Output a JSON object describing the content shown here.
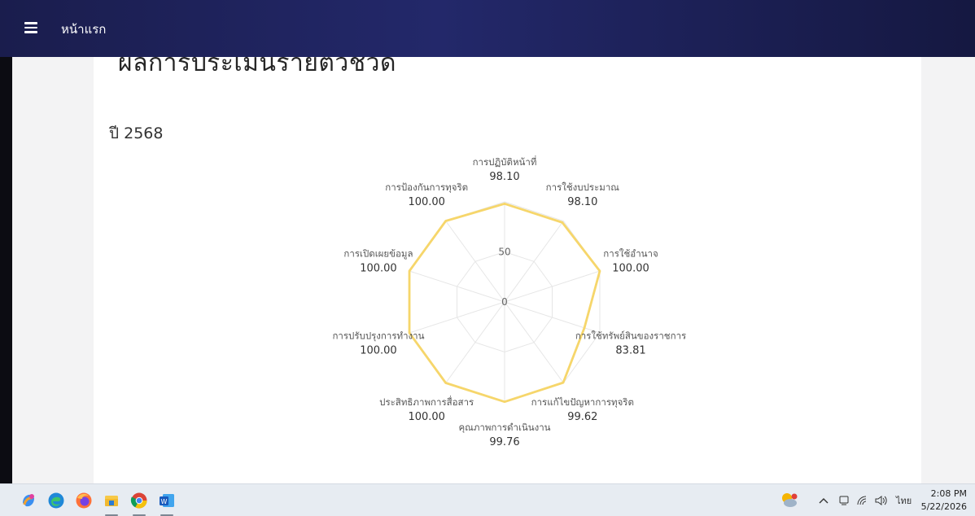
{
  "nav": {
    "title": "หน้าแรก"
  },
  "header": {
    "cut_heading": "ผลการประเมินรายตัวชี้วัด"
  },
  "section": {
    "year_label": "ปี 2568"
  },
  "chart_data": {
    "type": "radar",
    "title": "",
    "range": [
      0,
      100
    ],
    "ticks": [
      "0",
      "50"
    ],
    "series": [
      {
        "color": "#f6d66b",
        "values": [
          98.1,
          98.1,
          100.0,
          83.81,
          99.62,
          99.76,
          100.0,
          100.0,
          100.0,
          100.0
        ]
      }
    ],
    "categories": [
      "การปฏิบัติหน้าที่",
      "การใช้งบประมาณ",
      "การใช้อำนาจ",
      "การใช้ทรัพย์สินของราชการ",
      "การแก้ไขปัญหาการทุจริต",
      "คุณภาพการดำเนินงาน",
      "ประสิทธิภาพการสื่อสาร",
      "การปรับปรุงการทำงาน",
      "การเปิดเผยข้อมูล",
      "การป้องกันการทุจริต"
    ],
    "value_labels": [
      "98.10",
      "98.10",
      "100.00",
      "83.81",
      "99.62",
      "99.76",
      "100.00",
      "100.00",
      "100.00",
      "100.00"
    ],
    "grid": true
  },
  "taskbar": {
    "apps": [
      "copilot-icon",
      "edge-icon",
      "firefox-icon",
      "file-explorer-icon",
      "chrome-icon",
      "word-icon"
    ],
    "tray": {
      "language": "ไทย",
      "time": "2:08 PM",
      "date": "5/22/2026"
    }
  }
}
